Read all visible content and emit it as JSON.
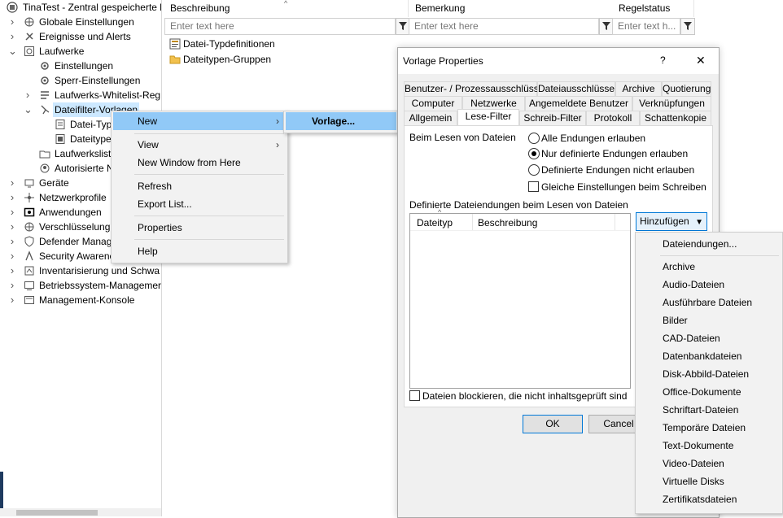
{
  "tree": {
    "root": "TinaTest - Zentral gespeicherte l",
    "items": [
      {
        "label": "Globale Einstellungen",
        "icon": "globe-gear-icon"
      },
      {
        "label": "Ereignisse und Alerts",
        "icon": "tools-icon"
      },
      {
        "label": "Laufwerke",
        "icon": "drive-icon"
      },
      {
        "label": "Einstellungen",
        "icon": "gear-icon"
      },
      {
        "label": "Sperr-Einstellungen",
        "icon": "gear-icon"
      },
      {
        "label": "Laufwerks-Whitelist-Reg",
        "icon": "list-icon"
      },
      {
        "label": "Dateifilter-Vorlagen",
        "icon": "filter-template-icon"
      },
      {
        "label": "Datei-Typ",
        "icon": "file-type-icon"
      },
      {
        "label": "Dateitype",
        "icon": "file-type-group-icon"
      },
      {
        "label": "Laufwerkslist",
        "icon": "folder-icon"
      },
      {
        "label": "Autorisierte N",
        "icon": "authorized-icon"
      },
      {
        "label": "Geräte",
        "icon": "devices-icon"
      },
      {
        "label": "Netzwerkprofile",
        "icon": "network-icon"
      },
      {
        "label": "Anwendungen",
        "icon": "apps-icon"
      },
      {
        "label": "Verschlüsselung",
        "icon": "lock-icon"
      },
      {
        "label": "Defender Manag",
        "icon": "shield-icon"
      },
      {
        "label": "Security Awarene",
        "icon": "awareness-icon"
      },
      {
        "label": "Inventarisierung und Schwa",
        "icon": "inventory-icon"
      },
      {
        "label": "Betriebssystem-Managemer",
        "icon": "monitor-icon"
      },
      {
        "label": "Management-Konsole",
        "icon": "console-icon"
      }
    ]
  },
  "list": {
    "columns": [
      {
        "label": "Beschreibung",
        "placeholder": "Enter text here"
      },
      {
        "label": "Bemerkung",
        "placeholder": "Enter text here"
      },
      {
        "label": "Regelstatus",
        "placeholder": "Enter text h..."
      }
    ],
    "rows": [
      "Datei-Typdefinitionen",
      "Dateitypen-Gruppen"
    ]
  },
  "context_menu": {
    "items": [
      "New",
      "View",
      "New Window from Here",
      "Refresh",
      "Export List...",
      "Properties",
      "Help"
    ],
    "submenu": "Vorlage..."
  },
  "dialog": {
    "title": "Vorlage Properties",
    "help": "?",
    "close": "✕",
    "tabs_row1": [
      "Benutzer- / Prozessausschlüsse",
      "Dateiausschlüsse",
      "Archive",
      "Quotierung"
    ],
    "tabs_row2": [
      "Computer",
      "Netzwerke",
      "Angemeldete Benutzer",
      "Verknüpfungen"
    ],
    "tabs_row3": [
      "Allgemein",
      "Lese-Filter",
      "Schreib-Filter",
      "Protokoll",
      "Schattenkopie"
    ],
    "read_label": "Beim Lesen von Dateien",
    "options": [
      "Alle Endungen erlauben",
      "Nur definierte Endungen erlauben",
      "Definierte Endungen nicht erlauben"
    ],
    "selected_option": 1,
    "same_settings": "Gleiche Einstellungen beim Schreiben",
    "defined_label": "Definierte Dateiendungen beim Lesen von Dateien",
    "grid_columns": [
      "Dateityp",
      "Beschreibung"
    ],
    "add_button": "Hinzufügen",
    "block_label": "Dateien blockieren, die nicht inhaltsgeprüft sind",
    "ok": "OK",
    "cancel": "Cancel"
  },
  "dropdown": {
    "first": "Dateiendungen...",
    "items": [
      "Archive",
      "Audio-Dateien",
      "Ausführbare Dateien",
      "Bilder",
      "CAD-Dateien",
      "Datenbankdateien",
      "Disk-Abbild-Dateien",
      "Office-Dokumente",
      "Schriftart-Dateien",
      "Temporäre Dateien",
      "Text-Dokumente",
      "Video-Dateien",
      "Virtuelle Disks",
      "Zertifikatsdateien"
    ]
  }
}
